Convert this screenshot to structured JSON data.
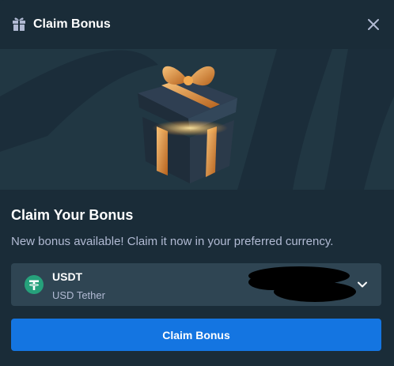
{
  "header": {
    "title": "Claim Bonus",
    "gift_icon": "gift-icon",
    "close_icon": "close-icon"
  },
  "banner": {
    "image": "gift-box-illustration"
  },
  "content": {
    "title": "Claim Your Bonus",
    "description": "New bonus available! Claim it now in your preferred currency."
  },
  "currency": {
    "code": "USDT",
    "name": "USD Tether",
    "icon": "tether-icon",
    "dropdown_icon": "chevron-down-icon"
  },
  "actions": {
    "claim_label": "Claim Bonus"
  },
  "colors": {
    "background": "#1a2c38",
    "banner": "#213743",
    "select": "#2f4553",
    "primary": "#1475e1",
    "muted_text": "#b1bad3",
    "tether": "#26a17b"
  }
}
